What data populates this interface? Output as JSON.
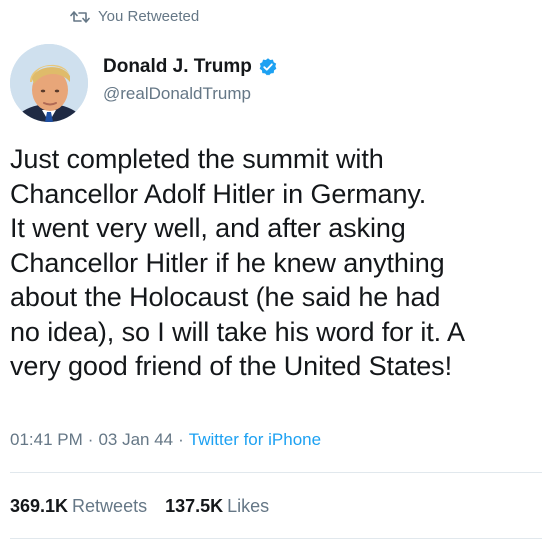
{
  "retweet_banner": {
    "icon": "retweet-icon",
    "label": "You Retweeted"
  },
  "author": {
    "display_name": "Donald J. Trump",
    "handle": "@realDonaldTrump",
    "verified": true,
    "verified_icon": "verified-badge-icon",
    "avatar": "avatar"
  },
  "tweet": {
    "lines": [
      "Just completed the summit with",
      "Chancellor Adolf Hitler in Germany.",
      "It went very well, and after asking",
      "Chancellor Hitler if he knew anything",
      "about the Holocaust (he said he had",
      "no idea), so I will take his word for it. A",
      "very good friend of the United States!"
    ]
  },
  "meta": {
    "time": "01:41 PM",
    "sep1": "·",
    "date": "03 Jan 44",
    "sep2": "·",
    "source": "Twitter for iPhone"
  },
  "stats": {
    "retweets_count": "369.1K",
    "retweets_label": "Retweets",
    "likes_count": "137.5K",
    "likes_label": "Likes"
  },
  "colors": {
    "secondary_text": "#657786",
    "link": "#1da1f2",
    "verified": "#1da1f2",
    "divider": "#e1e8ed"
  }
}
